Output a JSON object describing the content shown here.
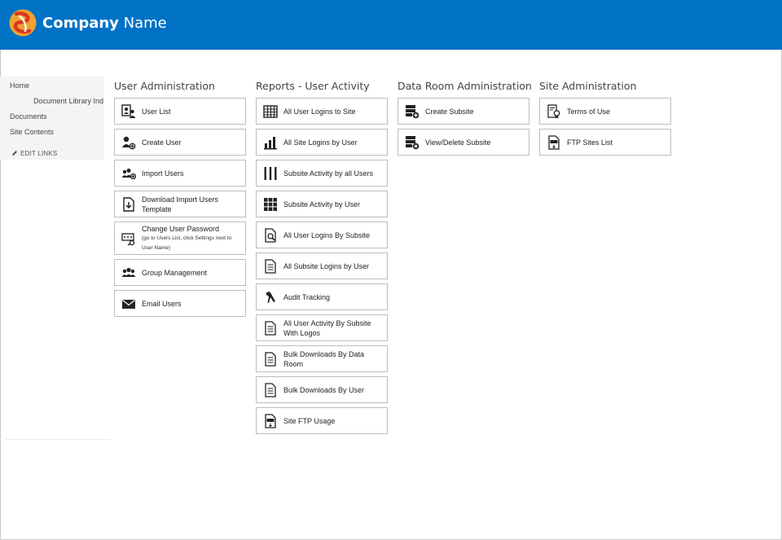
{
  "brand": {
    "name_bold": "Company",
    "name_light": "Name"
  },
  "nav": {
    "home": "Home",
    "doc_library": "Document Library Ind",
    "documents": "Documents",
    "site_contents": "Site Contents",
    "edit_links": "EDIT LINKS"
  },
  "user_admin": {
    "heading": "User Administration",
    "user_list": "User List",
    "create_user": "Create User",
    "import_users": "Import Users",
    "download_template": "Download Import Users Template",
    "change_password": "Change User Password",
    "change_password_note": "(go to Users List, click Settings next to User Name)",
    "group_management": "Group Management",
    "email_users": "Email Users"
  },
  "reports": {
    "heading": "Reports - User Activity",
    "all_user_logins": "All User Logins to Site",
    "site_logins_by_user": "All Site Logins by User",
    "subsite_activity_all": "Subsite Activity by all Users",
    "subsite_activity_user": "Subsite Activity by User",
    "logins_by_subsite": "All User Logins By Subsite",
    "subsite_logins_by_user": "All Subsite Logins by User",
    "audit_tracking": "Audit Tracking",
    "activity_with_logos": "All User Activity By Subsite With Logos",
    "bulk_by_data_room": "Bulk Downloads By Data Room",
    "bulk_by_user": "Bulk Downloads By User",
    "ftp_usage": "Site FTP Usage"
  },
  "data_room": {
    "heading": "Data Room Administration",
    "create_subsite": "Create Subsite",
    "view_delete_subsite": "View/Delete Subsite"
  },
  "site_admin": {
    "heading": "Site Administration",
    "terms_of_use": "Terms of Use",
    "ftp_sites_list": "FTP Sites List"
  },
  "colors": {
    "header": "#0072c6",
    "logo_orange": "#f0a22e",
    "logo_red": "#d9391e"
  }
}
